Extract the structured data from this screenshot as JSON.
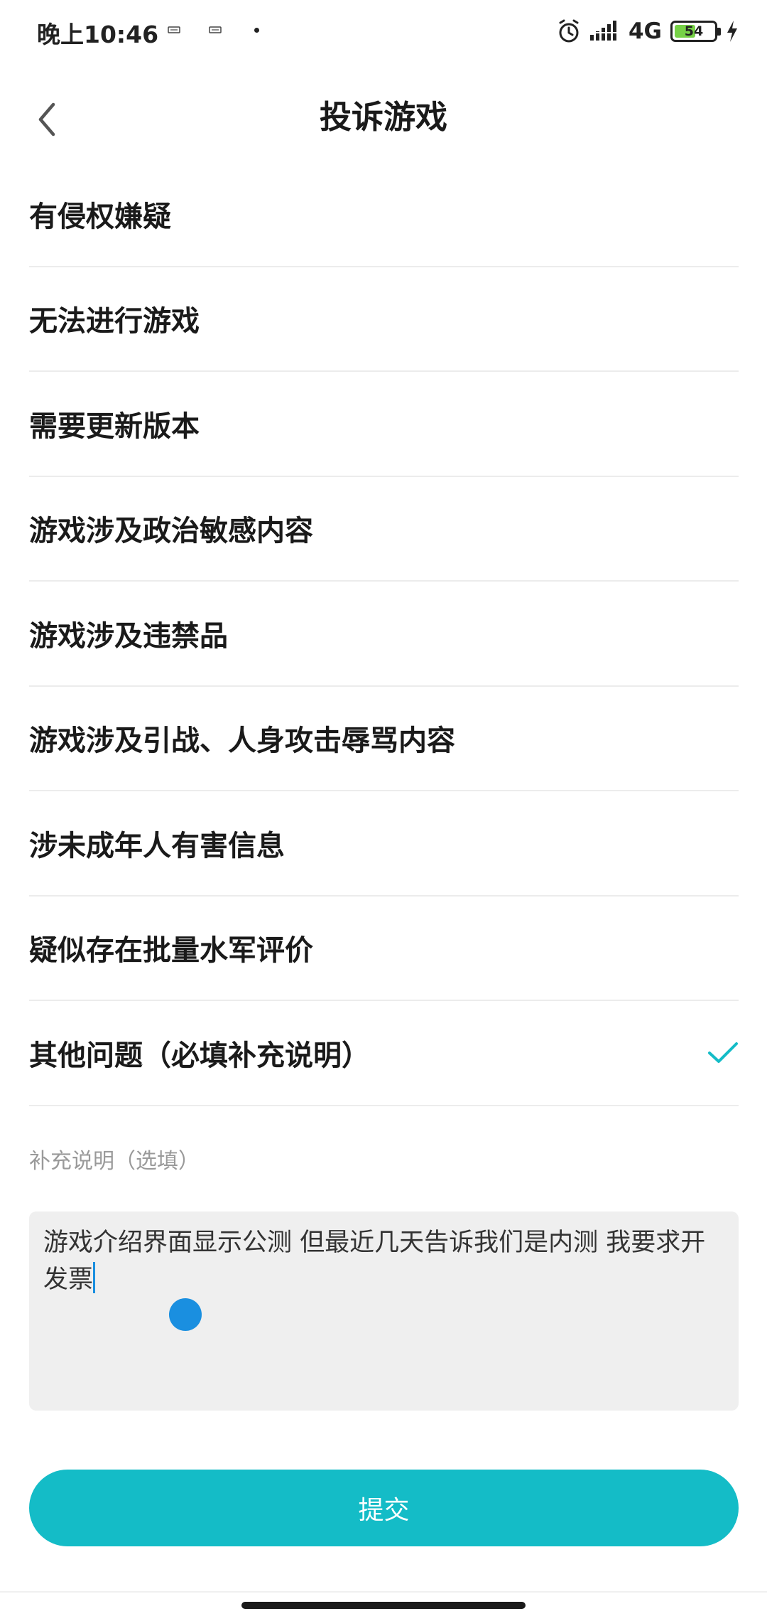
{
  "status_bar": {
    "time": "晚上10:46",
    "network": "4G",
    "battery_level": "54",
    "battery_fraction": 0.54,
    "icons": [
      "notification-icon",
      "notification-icon",
      "dot-icon",
      "alarm-icon",
      "signal-icon",
      "battery-icon",
      "charging-icon"
    ]
  },
  "header": {
    "title": "投诉游戏",
    "back_icon": "chevron-left-icon"
  },
  "reasons": [
    {
      "label": "有侵权嫌疑",
      "selected": false
    },
    {
      "label": "无法进行游戏",
      "selected": false
    },
    {
      "label": "需要更新版本",
      "selected": false
    },
    {
      "label": "游戏涉及政治敏感内容",
      "selected": false
    },
    {
      "label": "游戏涉及违禁品",
      "selected": false
    },
    {
      "label": "游戏涉及引战、人身攻击辱骂内容",
      "selected": false
    },
    {
      "label": "涉未成年人有害信息",
      "selected": false
    },
    {
      "label": "疑似存在批量水军评价",
      "selected": false
    },
    {
      "label": "其他问题（必填补充说明）",
      "selected": true
    }
  ],
  "supplement": {
    "label": "补充说明（选填）",
    "value": "游戏介绍界面显示公测 但最近几天告诉我们是内测 我要求开发票"
  },
  "submit": {
    "label": "提交"
  },
  "colors": {
    "accent": "#14bcc7",
    "check": "#14bcc7",
    "cursor": "#1a8fe0",
    "battery": "#76d146"
  }
}
